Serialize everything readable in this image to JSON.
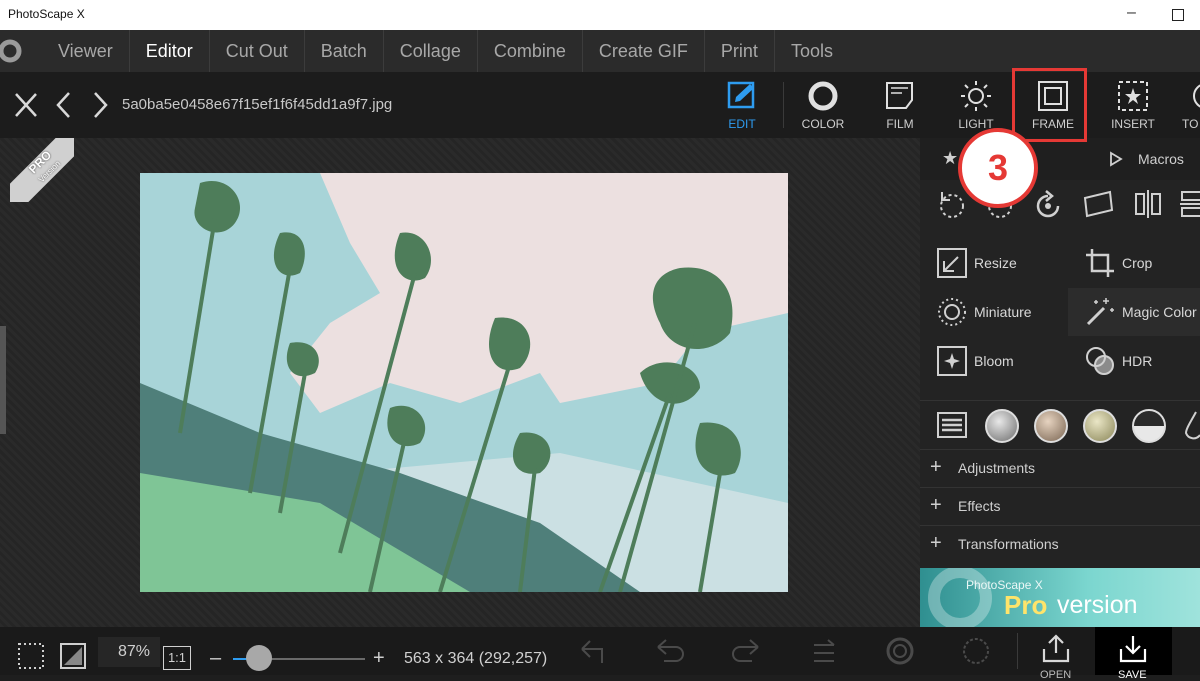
{
  "window": {
    "title": "PhotoScape X",
    "minimize": "–"
  },
  "menu": {
    "items": [
      "Viewer",
      "Editor",
      "Cut Out",
      "Batch",
      "Collage",
      "Combine",
      "Create GIF",
      "Print",
      "Tools"
    ],
    "active": "Editor"
  },
  "toolbar": {
    "filename": "5a0ba5e0458e67f15ef1f6f45dd1a9f7.jpg",
    "tools": [
      {
        "label": "EDIT",
        "icon": "edit-icon",
        "active": true
      },
      {
        "label": "COLOR",
        "icon": "color-icon"
      },
      {
        "label": "FILM",
        "icon": "film-icon"
      },
      {
        "label": "LIGHT",
        "icon": "light-icon"
      },
      {
        "label": "FRAME",
        "icon": "frame-icon"
      },
      {
        "label": "INSERT",
        "icon": "insert-icon"
      },
      {
        "label": "TO",
        "icon": "tools-icon"
      }
    ]
  },
  "pro_ribbon": {
    "line1": "PRO",
    "line2": "Version"
  },
  "panel": {
    "macros_label": "Macros",
    "features": [
      {
        "label": "Resize",
        "icon": "resize-icon"
      },
      {
        "label": "Crop",
        "icon": "crop-icon"
      },
      {
        "label": "Miniature",
        "icon": "miniature-icon"
      },
      {
        "label": "Magic Color",
        "icon": "magic-color-icon"
      },
      {
        "label": "Bloom",
        "icon": "bloom-icon"
      },
      {
        "label": "HDR",
        "icon": "hdr-icon"
      }
    ],
    "sections": [
      "Adjustments",
      "Effects",
      "Transformations"
    ],
    "banner": {
      "small": "PhotoScape X",
      "pro": "Pro",
      "rest": " version"
    }
  },
  "bottom": {
    "zoom": "87%",
    "ratio": "1:1",
    "minus": "–",
    "plus": "+",
    "dimensions": "563 x 364 (292,257)",
    "zoom_slider_fraction": 0.2,
    "open_label": "OPEN",
    "save_label": "SAVE"
  },
  "annotation": {
    "step": "3"
  },
  "colors": {
    "accent": "#2e9cf0",
    "annotation": "#e53935"
  }
}
